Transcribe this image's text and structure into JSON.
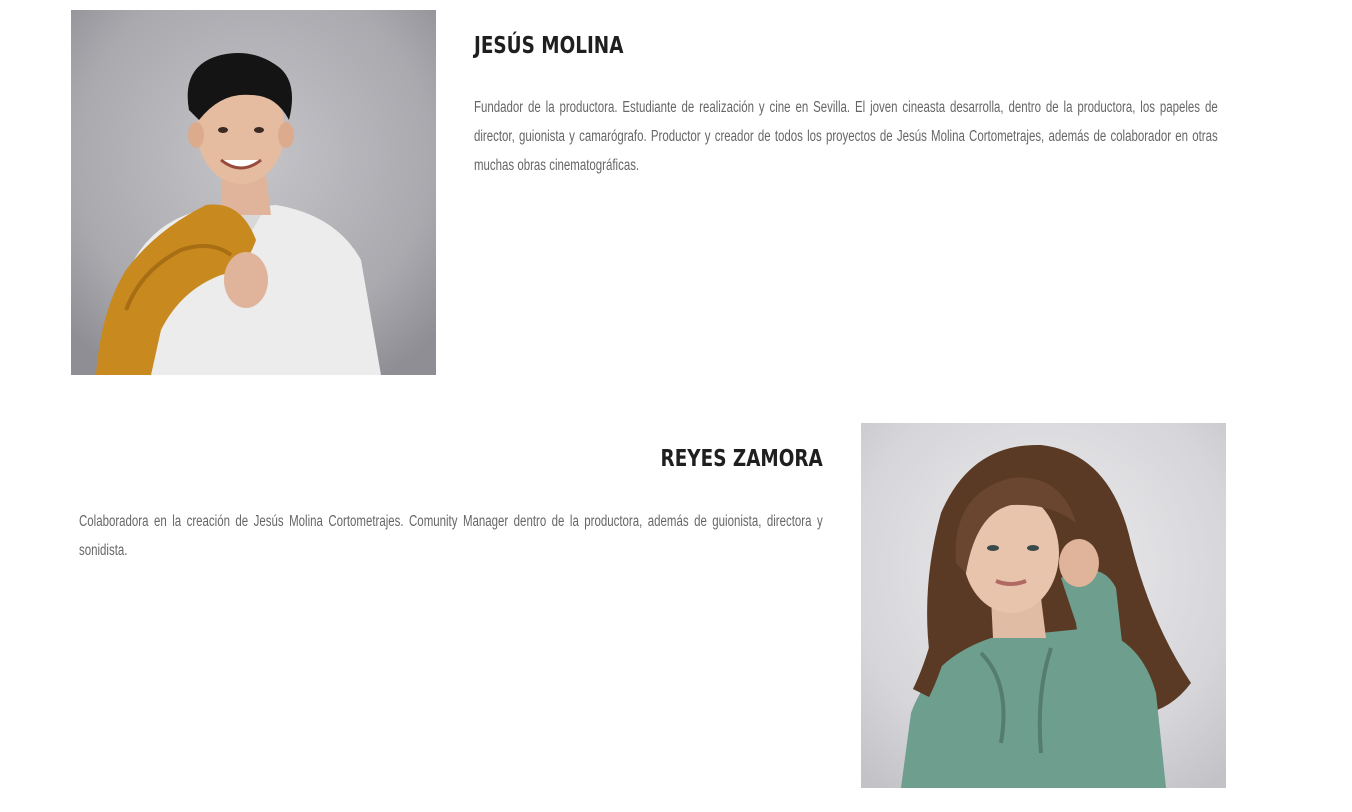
{
  "team": [
    {
      "name": "JESÚS MOLINA",
      "bio": "Fundador de la productora. Estudiante de realización y cine en Sevilla. El joven cineasta desarrolla, dentro de la productora, los papeles de director, guionista y camarógrafo. Productor y creador de todos los proyectos de Jesús Molina Cortometrajes, además de colaborador en otras muchas obras cinematográficas."
    },
    {
      "name": "REYES ZAMORA",
      "bio": "Colaboradora en la creación de Jesús Molina Cortometrajes. Comunity Manager dentro de la productora, además de guionista, directora y sonidista."
    }
  ],
  "colors": {
    "heading": "#1f1f1f",
    "body_text": "#666666",
    "background": "#ffffff"
  }
}
